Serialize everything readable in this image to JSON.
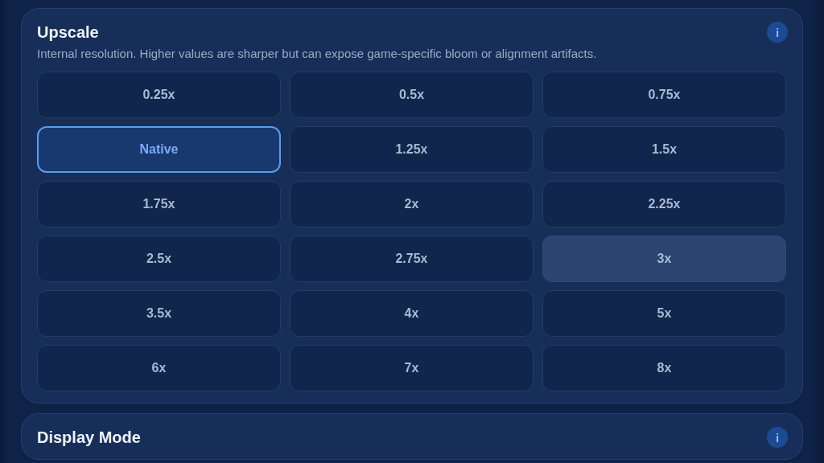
{
  "sections": [
    {
      "title": "Upscale",
      "description": "Internal resolution. Higher values are sharper but can expose game-specific bloom or alignment artifacts.",
      "info": "i",
      "options": [
        {
          "label": "0.25x",
          "selected": false,
          "hovered": false
        },
        {
          "label": "0.5x",
          "selected": false,
          "hovered": false
        },
        {
          "label": "0.75x",
          "selected": false,
          "hovered": false
        },
        {
          "label": "Native",
          "selected": true,
          "hovered": false
        },
        {
          "label": "1.25x",
          "selected": false,
          "hovered": false
        },
        {
          "label": "1.5x",
          "selected": false,
          "hovered": false
        },
        {
          "label": "1.75x",
          "selected": false,
          "hovered": false
        },
        {
          "label": "2x",
          "selected": false,
          "hovered": false
        },
        {
          "label": "2.25x",
          "selected": false,
          "hovered": false
        },
        {
          "label": "2.5x",
          "selected": false,
          "hovered": false
        },
        {
          "label": "2.75x",
          "selected": false,
          "hovered": false
        },
        {
          "label": "3x",
          "selected": false,
          "hovered": true
        },
        {
          "label": "3.5x",
          "selected": false,
          "hovered": false
        },
        {
          "label": "4x",
          "selected": false,
          "hovered": false
        },
        {
          "label": "5x",
          "selected": false,
          "hovered": false
        },
        {
          "label": "6x",
          "selected": false,
          "hovered": false
        },
        {
          "label": "7x",
          "selected": false,
          "hovered": false
        },
        {
          "label": "8x",
          "selected": false,
          "hovered": false
        }
      ]
    },
    {
      "title": "Display Mode",
      "info": "i"
    }
  ]
}
